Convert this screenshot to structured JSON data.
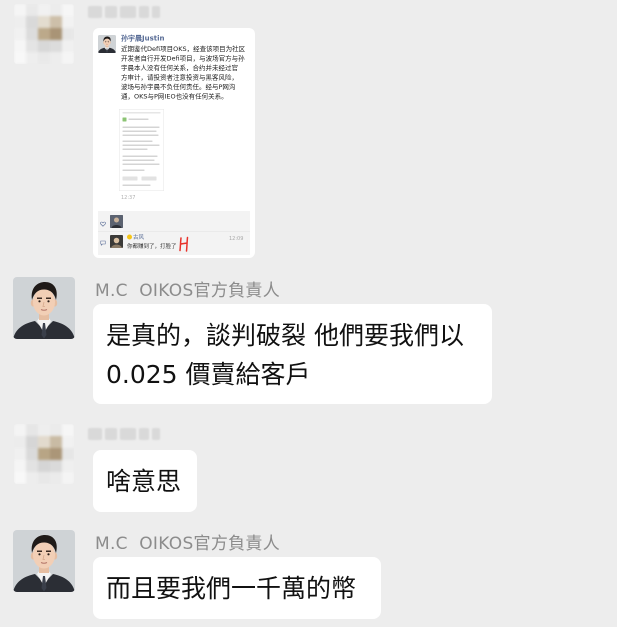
{
  "colors": {
    "background": "#ededed",
    "bubble": "#ffffff",
    "sender_name": "#8c8c8c",
    "message_text": "#111111",
    "moments_link": "#576b95",
    "annotation_red": "#e8322b"
  },
  "messages": [
    {
      "avatar_icon": "mosaic-avatar",
      "type": "image",
      "image": {
        "poster_name": "孙宇晨Justin",
        "post_lines": [
          "近期鉴代Defi项目OKS，经查该项目为社区",
          "开发者自行开发Defi项目，与波场官方与孙",
          "宇晨本人没有任何关系，合约并未经过官",
          "方审计，请投资者注意投资与黑客风险，",
          "波场与孙宇晨不负任何责任。经与P网沟",
          "通，OKS与P网IEO也没有任何关系。"
        ],
        "post_time": "12:37",
        "likes_icon": "heart-icon",
        "comments_icon": "comment-icon",
        "comment": {
          "author": "古风",
          "text": "你都赚到了，打脸了",
          "time": "12:09"
        }
      }
    },
    {
      "avatar_icon": "user-avatar",
      "sender_name": "M.C  OIKOS官方負責人",
      "type": "text",
      "lines": [
        "是真的，談判破裂 他們要我們以",
        "0.025 價賣給客戶"
      ]
    },
    {
      "avatar_icon": "mosaic-avatar",
      "type": "text",
      "lines": [
        "啥意思"
      ]
    },
    {
      "avatar_icon": "user-avatar",
      "sender_name": "M.C  OIKOS官方負責人",
      "type": "text",
      "lines": [
        "而且要我們一千萬的幣"
      ]
    }
  ]
}
